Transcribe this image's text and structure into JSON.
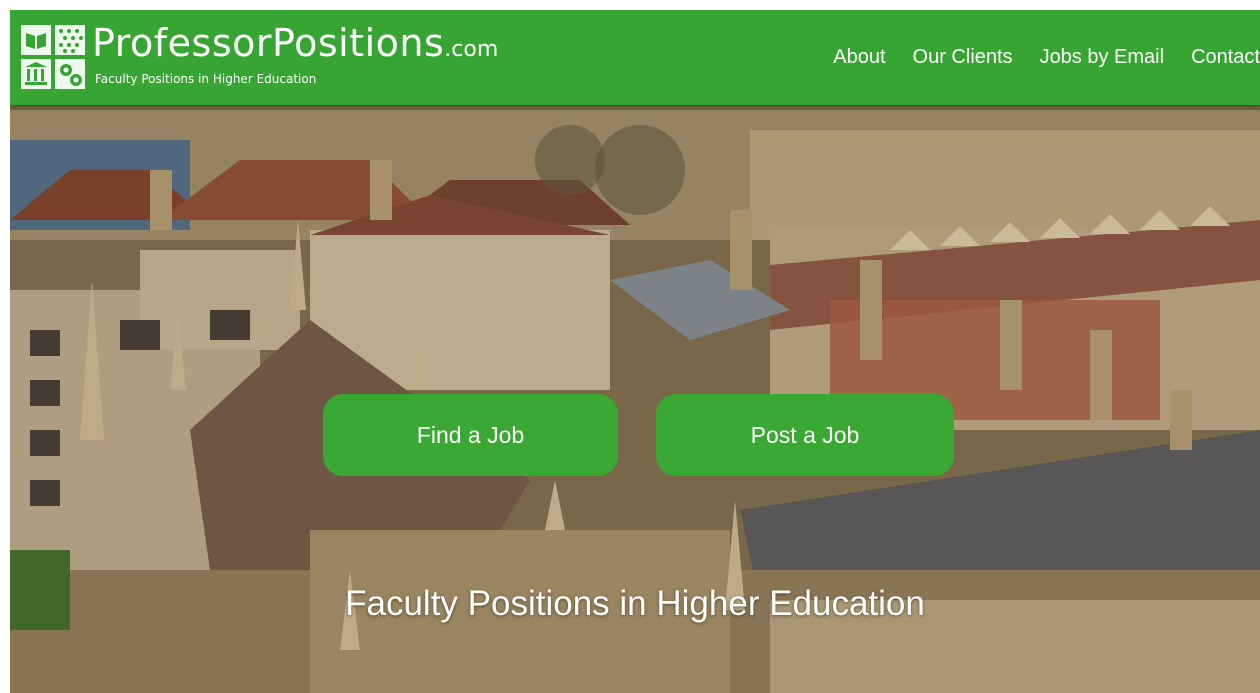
{
  "header": {
    "logo_title": "ProfessorPositions",
    "logo_title_suffix": ".com",
    "logo_tagline": "Faculty Positions in Higher Education",
    "logo_icon": "university-logo-icon"
  },
  "nav": {
    "items": [
      {
        "label": "About"
      },
      {
        "label": "Our Clients"
      },
      {
        "label": "Jobs by Email"
      },
      {
        "label": "Contact"
      }
    ]
  },
  "hero": {
    "find_job_label": "Find a Job",
    "post_job_label": "Post a Job",
    "tagline": "Faculty Positions in Higher Education"
  },
  "colors": {
    "brand_green": "#37a532",
    "button_green": "#3aa934",
    "text_on_green": "#ffffff"
  }
}
